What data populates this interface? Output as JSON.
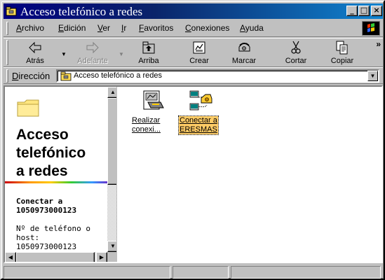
{
  "window": {
    "title": "Acceso telefónico a redes",
    "buttons": {
      "minimize": "_",
      "maximize": "□",
      "close": "×"
    }
  },
  "menubar": {
    "items": [
      "Archivo",
      "Edición",
      "Ver",
      "Ir",
      "Favoritos",
      "Conexiones",
      "Ayuda"
    ]
  },
  "toolbar": {
    "back": "Atrás",
    "forward": "Adelante",
    "up": "Arriba",
    "create": "Crear",
    "dial": "Marcar",
    "cut": "Cortar",
    "copy": "Copiar",
    "more": "»"
  },
  "address": {
    "label": "Dirección",
    "value": "Acceso telefónico a redes"
  },
  "left_pane": {
    "title_line1": "Acceso",
    "title_line2": "telefónico",
    "title_line3": "a redes",
    "connect_line1": "Conectar a",
    "connect_line2": "1050973000123",
    "phone_label_line1": "Nº de teléfono o",
    "phone_label_line2": "host:",
    "phone_value": "1050973000123"
  },
  "items": [
    {
      "line1": "Realizar",
      "line2": "conexi...",
      "icon": "new-connection-icon",
      "selected": false
    },
    {
      "line1": "Conectar a",
      "line2": "ERESMAS",
      "icon": "dialup-connection-icon",
      "selected": true
    }
  ],
  "colors": {
    "title_bar_start": "#000080",
    "title_bar_end": "#1084d0",
    "selection": "#ffcc66"
  }
}
